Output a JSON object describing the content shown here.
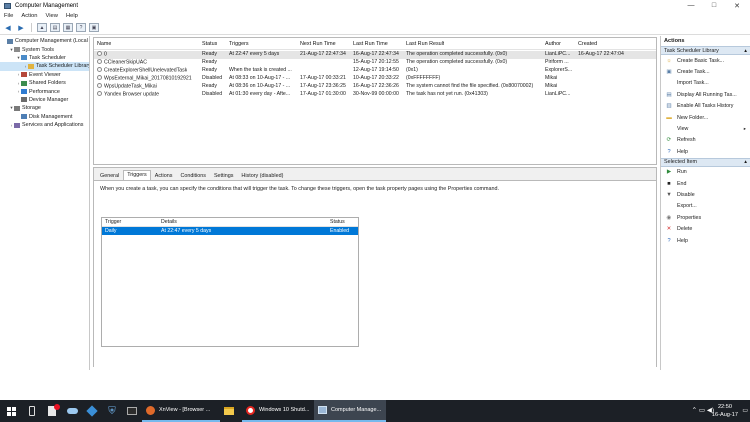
{
  "window": {
    "title": "Computer Management",
    "minimize": "—",
    "maximize": "□",
    "close": "✕"
  },
  "menu": [
    "File",
    "Action",
    "View",
    "Help"
  ],
  "toolbar_icons": [
    "back-arrow-icon",
    "forward-arrow-icon",
    "up-folder-icon",
    "console-tree-icon",
    "properties-icon",
    "help-icon",
    "mmc-icon"
  ],
  "tree": [
    {
      "label": "Computer Management (Local",
      "level": 0,
      "exp": "",
      "icon": "computer-icon"
    },
    {
      "label": "System Tools",
      "level": 1,
      "exp": "▾",
      "icon": "tools-icon"
    },
    {
      "label": "Task Scheduler",
      "level": 2,
      "exp": "▾",
      "icon": "clock-icon"
    },
    {
      "label": "Task Scheduler Library",
      "level": 3,
      "exp": "›",
      "icon": "folder-icon",
      "selected": true
    },
    {
      "label": "Event Viewer",
      "level": 2,
      "exp": "›",
      "icon": "event-icon"
    },
    {
      "label": "Shared Folders",
      "level": 2,
      "exp": "›",
      "icon": "share-icon"
    },
    {
      "label": "Performance",
      "level": 2,
      "exp": "›",
      "icon": "perf-icon"
    },
    {
      "label": "Device Manager",
      "level": 2,
      "exp": "",
      "icon": "device-icon"
    },
    {
      "label": "Storage",
      "level": 1,
      "exp": "▾",
      "icon": "storage-icon"
    },
    {
      "label": "Disk Management",
      "level": 2,
      "exp": "",
      "icon": "disk-icon"
    },
    {
      "label": "Services and Applications",
      "level": 1,
      "exp": "›",
      "icon": "services-icon"
    }
  ],
  "task_columns": [
    "Name",
    "Status",
    "Triggers",
    "Next Run Time",
    "Last Run Time",
    "Last Run Result",
    "Author",
    "Created"
  ],
  "tasks": [
    {
      "name": "0",
      "status": "Ready",
      "triggers": "At 22:47 every 5 days",
      "next": "21-Aug-17 22:47:34",
      "last": "16-Aug-17 22:47:34",
      "result": "The operation completed successfully. (0x0)",
      "author": "LianLiPC...",
      "created": "16-Aug-17 22:47:04"
    },
    {
      "name": "CCleanerSkipUAC",
      "status": "Ready",
      "triggers": "",
      "next": "",
      "last": "15-Aug-17 20:12:55",
      "result": "The operation completed successfully. (0x0)",
      "author": "Piriform ...",
      "created": ""
    },
    {
      "name": "CreateExplorerShellUnelevatedTask",
      "status": "Ready",
      "triggers": "When the task is created ...",
      "next": "",
      "last": "12-Aug-17 19:14:50",
      "result": "(0x1)",
      "author": "ExplorerS...",
      "created": ""
    },
    {
      "name": "WpsExternal_Mikai_20170810192921",
      "status": "Disabled",
      "triggers": "At 08:33 on 10-Aug-17 - ...",
      "next": "17-Aug-17 00:33:21",
      "last": "10-Aug-17 20:33:22",
      "result": "(0xFFFFFFFF)",
      "author": "Mikai",
      "created": ""
    },
    {
      "name": "WpsUpdateTask_Mikai",
      "status": "Ready",
      "triggers": "At 08:36 on 10-Aug-17 - ...",
      "next": "17-Aug-17 23:36:25",
      "last": "16-Aug-17 22:36:26",
      "result": "The system cannot find the file specified. (0x80070002)",
      "author": "Mikai",
      "created": ""
    },
    {
      "name": "Yandex Browser update",
      "status": "Disabled",
      "triggers": "At 01:30 every day - Afte...",
      "next": "17-Aug-17 01:30:00",
      "last": "30-Nov-99 00:00:00",
      "result": "The task has not yet run. (0x41303)",
      "author": "LianLiPC...",
      "created": ""
    }
  ],
  "tabs": [
    "General",
    "Triggers",
    "Actions",
    "Conditions",
    "Settings",
    "History (disabled)"
  ],
  "active_tab": "Triggers",
  "triggers_intro": "When you create a task, you can specify the conditions that will trigger the task.  To change these triggers, open the task property pages using the Properties command.",
  "trigger_columns": [
    "Trigger",
    "Details",
    "Status"
  ],
  "triggers": [
    {
      "trigger": "Daily",
      "details": "At 22:47 every 5 days",
      "status": "Enabled"
    }
  ],
  "actions_title": "Actions",
  "action_sections": [
    {
      "title": "Task Scheduler Library",
      "items": [
        {
          "label": "Create Basic Task...",
          "icon": "create-basic-task-icon",
          "glyph": "☼",
          "color": "#d69a1a"
        },
        {
          "label": "Create Task...",
          "icon": "create-task-icon",
          "glyph": "▣",
          "color": "#5a7fa8"
        },
        {
          "label": "Import Task...",
          "icon": "import-icon",
          "glyph": "",
          "color": "#333"
        },
        {
          "label": "Display All Running Tas...",
          "icon": "running-tasks-icon",
          "glyph": "▤",
          "color": "#5a7fa8"
        },
        {
          "label": "Enable All Tasks History",
          "icon": "history-icon",
          "glyph": "▥",
          "color": "#5a7fa8"
        },
        {
          "label": "New Folder...",
          "icon": "new-folder-icon",
          "glyph": "▬",
          "color": "#e0b341"
        },
        {
          "label": "View",
          "icon": "",
          "glyph": "",
          "color": "#333",
          "submenu": true
        },
        {
          "label": "Refresh",
          "icon": "refresh-icon",
          "glyph": "⟳",
          "color": "#2f8a3b"
        },
        {
          "label": "Help",
          "icon": "help-icon",
          "glyph": "?",
          "color": "#1f5fb5"
        }
      ]
    },
    {
      "title": "Selected Item",
      "items": [
        {
          "label": "Run",
          "icon": "run-icon",
          "glyph": "▶",
          "color": "#2f8a3b"
        },
        {
          "label": "End",
          "icon": "end-icon",
          "glyph": "■",
          "color": "#222"
        },
        {
          "label": "Disable",
          "icon": "disable-icon",
          "glyph": "▼",
          "color": "#555"
        },
        {
          "label": "Export...",
          "icon": "",
          "glyph": "",
          "color": "#333"
        },
        {
          "label": "Properties",
          "icon": "properties-icon",
          "glyph": "◉",
          "color": "#777"
        },
        {
          "label": "Delete",
          "icon": "delete-icon",
          "glyph": "✕",
          "color": "#d32f2f"
        },
        {
          "label": "Help",
          "icon": "help-icon",
          "glyph": "?",
          "color": "#1f5fb5"
        }
      ]
    }
  ],
  "taskbar": {
    "apps": [
      {
        "label": "XnView - [Browser ...",
        "icon": "xnview-icon",
        "state": "open"
      },
      {
        "label": "",
        "icon": "file-explorer-icon",
        "state": "none"
      },
      {
        "label": "Windows 10 Shutd...",
        "icon": "yandex-browser-icon",
        "state": "open"
      },
      {
        "label": "Computer Manage...",
        "icon": "computer-management-icon",
        "state": "active"
      }
    ],
    "time": "22:50",
    "date": "16-Aug-17"
  }
}
